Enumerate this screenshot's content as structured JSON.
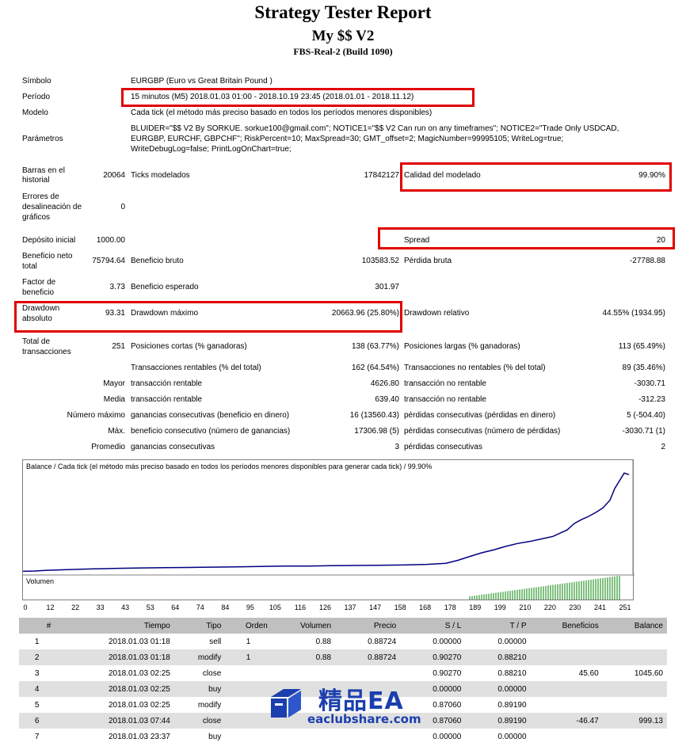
{
  "header": {
    "title": "Strategy Tester Report",
    "expert": "My $$ V2",
    "server": "FBS-Real-2 (Build 1090)"
  },
  "info": {
    "symbol_label": "Símbolo",
    "symbol_value": "EURGBP (Euro vs Great Britain Pound )",
    "period_label": "Período",
    "period_value": "15 minutos (M5) 2018.01.03 01:00 - 2018.10.19 23:45 (2018.01.01 - 2018.11.12)",
    "model_label": "Modelo",
    "model_value": "Cada tick (el método más preciso basado en todos los períodos menores disponibles)",
    "params_label": "Parámetros",
    "params_lines": [
      "BLUIDER=\"$$ V2 By SORKUE. sorkue100@gmail.com\"; NOTICE1=\"$$ V2 Can run on any timeframes\"; NOTICE2=\"Trade Only USDCAD,",
      "EURGBP, EURCHF, GBPCHF\"; RiskPercent=10; MaxSpread=30; GMT_offset=2; MagicNumber=99995105; WriteLog=true;",
      "WriteDebugLog=false; PrintLogOnChart=true;"
    ]
  },
  "stats": {
    "bars_label_1": "Barras en el",
    "bars_label_2": "historial",
    "bars_value": "20064",
    "ticks_label": "Ticks modelados",
    "ticks_value": "17842127",
    "quality_label": "Calidad del modelado",
    "quality_value": "99.90%",
    "errors_label_1": "Errores de",
    "errors_label_2": "desalineación de",
    "errors_label_3": "gráficos",
    "errors_value": "0",
    "deposit_label": "Depósito inicial",
    "deposit_value": "1000.00",
    "spread_label": "Spread",
    "spread_value": "20",
    "net_label_1": "Beneficio neto",
    "net_label_2": "total",
    "net_value": "75794.64",
    "gross_profit_label": "Beneficio bruto",
    "gross_profit_value": "103583.52",
    "gross_loss_label": "Pérdida bruta",
    "gross_loss_value": "-27788.88",
    "pf_label_1": "Factor de",
    "pf_label_2": "beneficio",
    "pf_value": "3.73",
    "expected_label": "Beneficio esperado",
    "expected_value": "301.97",
    "dd_abs_label_1": "Drawdown",
    "dd_abs_label_2": "absoluto",
    "dd_abs_value": "93.31",
    "dd_max_label": "Drawdown máximo",
    "dd_max_value": "20663.96 (25.80%)",
    "dd_rel_label": "Drawdown relativo",
    "dd_rel_value": "44.55% (1934.95)",
    "total_label_1": "Total de",
    "total_label_2": "transacciones",
    "total_value": "251",
    "short_label": "Posiciones cortas (% ganadoras)",
    "short_value": "138 (63.77%)",
    "long_label": "Posiciones largas (% ganadoras)",
    "long_value": "113 (65.49%)",
    "profit_trades_label": "Transacciones rentables (% del total)",
    "profit_trades_value": "162 (64.54%)",
    "loss_trades_label": "Transacciones no rentables (% del total)",
    "loss_trades_value": "89 (35.46%)",
    "largest_label": "Mayor",
    "largest_profit_label": "transacción rentable",
    "largest_profit_value": "4626.80",
    "largest_loss_label": "transacción no rentable",
    "largest_loss_value": "-3030.71",
    "average_label": "Media",
    "average_profit_label": "transacción rentable",
    "average_profit_value": "639.40",
    "average_loss_label": "transacción no rentable",
    "average_loss_value": "-312.23",
    "max_label": "Número máximo",
    "max_wins_label": "ganancias consecutivas (beneficio en dinero)",
    "max_wins_value": "16 (13560.43)",
    "max_losses_label": "pérdidas consecutivas (pérdidas en dinero)",
    "max_losses_value": "5 (-504.40)",
    "maximal_label": "Máx.",
    "maximal_profit_label": "beneficio consecutivo (número de ganancias)",
    "maximal_profit_value": "17306.98 (5)",
    "maximal_loss_label": "pérdidas consecutivas (número de pérdidas)",
    "maximal_loss_value": "-3030.71 (1)",
    "avg_cons_label": "Promedio",
    "avg_wins_label": "ganancias consecutivas",
    "avg_wins_value": "3",
    "avg_losses_label": "pérdidas consecutivas",
    "avg_losses_value": "2"
  },
  "chart_data": {
    "type": "line",
    "title": "Balance / Cada tick (el método más preciso basado en todos los períodos menores disponibles para generar cada tick)  / 99.90%",
    "y_ticks": [
      "79624",
      "59718",
      "39812",
      "19906",
      "0"
    ],
    "ylim": [
      0,
      79624
    ],
    "xlim": [
      0,
      256
    ],
    "x_ticks": [
      "0",
      "12",
      "22",
      "33",
      "43",
      "53",
      "64",
      "74",
      "84",
      "95",
      "105",
      "116",
      "126",
      "137",
      "147",
      "158",
      "168",
      "178",
      "189",
      "199",
      "210",
      "220",
      "230",
      "241",
      "251"
    ],
    "volume_label": "Volumen",
    "volume_from": 188,
    "volume_to": 251,
    "series": [
      {
        "color": "#000080",
        "x": [
          0,
          5,
          10,
          20,
          30,
          40,
          50,
          60,
          70,
          80,
          90,
          100,
          110,
          120,
          130,
          140,
          150,
          160,
          170,
          178,
          183,
          188,
          193,
          198,
          203,
          208,
          213,
          218,
          223,
          226,
          229,
          232,
          235,
          238,
          241,
          244,
          247,
          249,
          251,
          253,
          255
        ],
        "y": [
          1000,
          1200,
          1800,
          2400,
          2900,
          3300,
          3600,
          3800,
          4000,
          4200,
          4500,
          4800,
          5000,
          5100,
          5300,
          5500,
          5700,
          5900,
          6400,
          7200,
          9500,
          12500,
          15300,
          17500,
          20200,
          22500,
          24000,
          26000,
          28000,
          30500,
          33000,
          38000,
          41000,
          43500,
          46500,
          50000,
          56000,
          65000,
          71000,
          77000,
          75794
        ]
      }
    ]
  },
  "trades": {
    "headers": [
      "#",
      "Tiempo",
      "Tipo",
      "Orden",
      "Volumen",
      "Precio",
      "S / L",
      "T / P",
      "Beneficios",
      "Balance"
    ],
    "rows": [
      [
        "1",
        "2018.01.03 01:18",
        "sell",
        "1",
        "0.88",
        "0.88724",
        "0.00000",
        "0.00000",
        "",
        ""
      ],
      [
        "2",
        "2018.01.03 01:18",
        "modify",
        "1",
        "0.88",
        "0.88724",
        "0.90270",
        "0.88210",
        "",
        ""
      ],
      [
        "3",
        "2018.01.03 02:25",
        "close",
        "",
        "",
        "",
        "0.90270",
        "0.88210",
        "45.60",
        "1045.60"
      ],
      [
        "4",
        "2018.01.03 02:25",
        "buy",
        "",
        "",
        "",
        "0.00000",
        "0.00000",
        "",
        ""
      ],
      [
        "5",
        "2018.01.03 02:25",
        "modify",
        "",
        "",
        "",
        "0.87060",
        "0.89190",
        "",
        ""
      ],
      [
        "6",
        "2018.01.03 07:44",
        "close",
        "",
        "",
        "",
        "0.87060",
        "0.89190",
        "-46.47",
        "999.13"
      ],
      [
        "7",
        "2018.01.03 23:37",
        "buy",
        "",
        "",
        "",
        "0.00000",
        "0.00000",
        "",
        ""
      ]
    ]
  },
  "watermark": {
    "line1": "精品EA",
    "line2": "eaclubshare.com"
  },
  "colors": {
    "highlight": "#e00000",
    "balance_line": "#000080",
    "volume_bars": "#008000",
    "table_header": "#c0c0c0",
    "table_alt_row": "#e0e0e0",
    "watermark": "#1c3fae"
  }
}
